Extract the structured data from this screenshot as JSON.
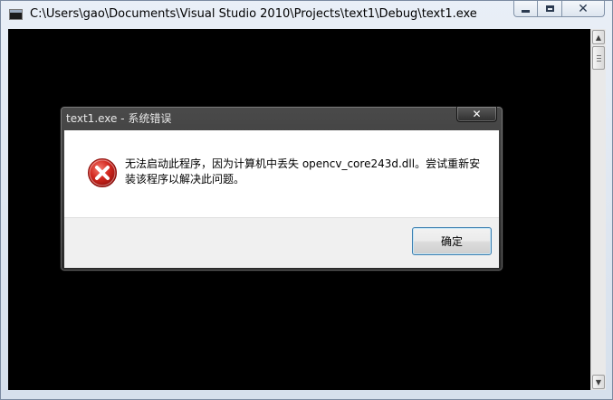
{
  "console": {
    "title": "C:\\Users\\gao\\Documents\\Visual Studio 2010\\Projects\\text1\\Debug\\text1.exe",
    "icon": "console-app-icon",
    "caption_buttons": [
      "minimize",
      "maximize",
      "close"
    ]
  },
  "dialog": {
    "title": "text1.exe - 系统错误",
    "icon": "error-icon",
    "message": "无法启动此程序，因为计算机中丢失 opencv_core243d.dll。尝试重新安装该程序以解决此问题。",
    "ok_label": "确定",
    "close_glyph": "✕"
  },
  "colors": {
    "console_background": "#000000",
    "dialog_frame": "#3a3a3a",
    "error_red": "#c8201c",
    "ok_border": "#3c7fb1"
  }
}
